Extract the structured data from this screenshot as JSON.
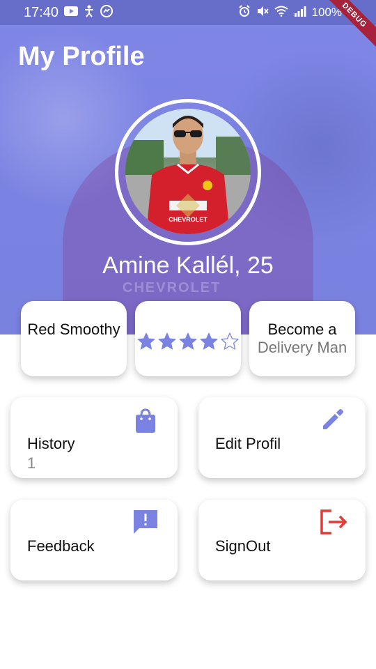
{
  "status_bar": {
    "time": "17:40",
    "battery": "100%",
    "icons_left": [
      "youtube-icon",
      "accessibility-icon",
      "messenger-icon"
    ],
    "icons_right": [
      "alarm-icon",
      "mute-icon",
      "wifi-icon",
      "signal-icon",
      "battery-icon"
    ]
  },
  "debug_ribbon": "DEBUG",
  "header": {
    "title": "My Profile"
  },
  "profile": {
    "name": "Amine Kallél, 25"
  },
  "top_cards": {
    "level": {
      "label": "Red Smoothy"
    },
    "rating": {
      "value": 4,
      "max": 5
    },
    "delivery": {
      "title": "Become a",
      "subtitle": "Delivery Man"
    }
  },
  "menu": {
    "history": {
      "label": "History",
      "count": "1",
      "icon": "shopping-bag-icon"
    },
    "edit_profile": {
      "label": "Edit Profil",
      "icon": "pencil-icon"
    },
    "feedback": {
      "label": "Feedback",
      "icon": "feedback-icon"
    },
    "sign_out": {
      "label": "SignOut",
      "icon": "logout-icon"
    }
  },
  "colors": {
    "accent": "#7b83e2",
    "danger": "#e53935",
    "hero_tint": "#7b83e2"
  }
}
